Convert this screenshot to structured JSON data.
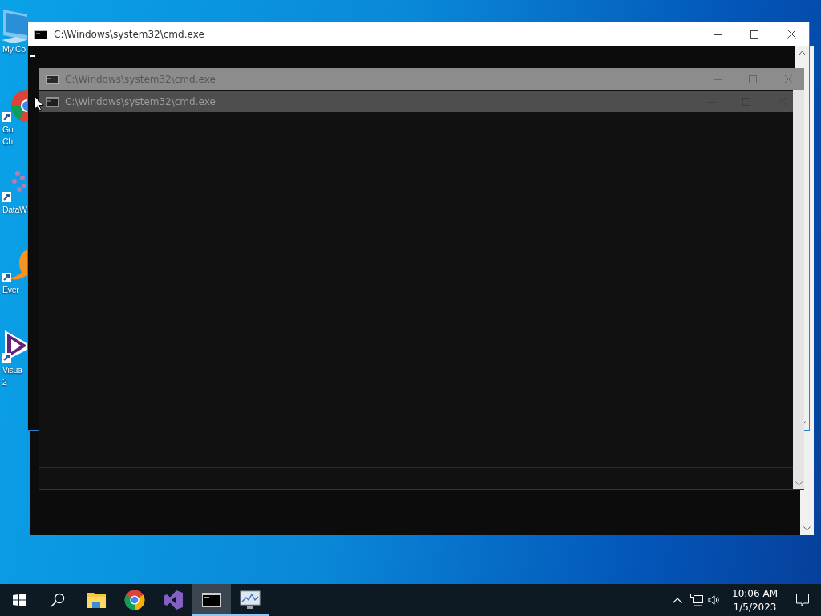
{
  "desktop_icons": [
    {
      "kind": "computer",
      "label_lines": [
        "My Co"
      ]
    },
    {
      "kind": "chrome",
      "label_lines": [
        "Go",
        "Ch"
      ]
    },
    {
      "kind": "scatter",
      "label_lines": [
        "DataW"
      ]
    },
    {
      "kind": "orange",
      "label_lines": [
        "Ever"
      ]
    },
    {
      "kind": "vs",
      "label_lines": [
        "Visua",
        "2"
      ]
    }
  ],
  "windows": [
    {
      "kind": "frame"
    },
    {
      "kind": "console",
      "title": "C:\\Windows\\system32\\cmd.exe"
    },
    {
      "kind": "ghost",
      "title": "C:\\Windows\\system32\\cmd.exe"
    },
    {
      "kind": "ghost-bar",
      "title": "C:\\Windows\\system32\\cmd.exe"
    }
  ],
  "taskbar": {
    "items": [
      {
        "kind": "start",
        "selected": false,
        "running": false
      },
      {
        "kind": "search",
        "selected": false,
        "running": false
      },
      {
        "kind": "folder",
        "selected": false,
        "running": false
      },
      {
        "kind": "chrome",
        "selected": false,
        "running": false
      },
      {
        "kind": "vs",
        "selected": false,
        "running": false
      },
      {
        "kind": "cmd",
        "selected": true,
        "running": true
      },
      {
        "kind": "monitor",
        "selected": false,
        "running": true
      }
    ],
    "clock": {
      "time": "10:06 AM",
      "date": "1/5/2023"
    }
  }
}
